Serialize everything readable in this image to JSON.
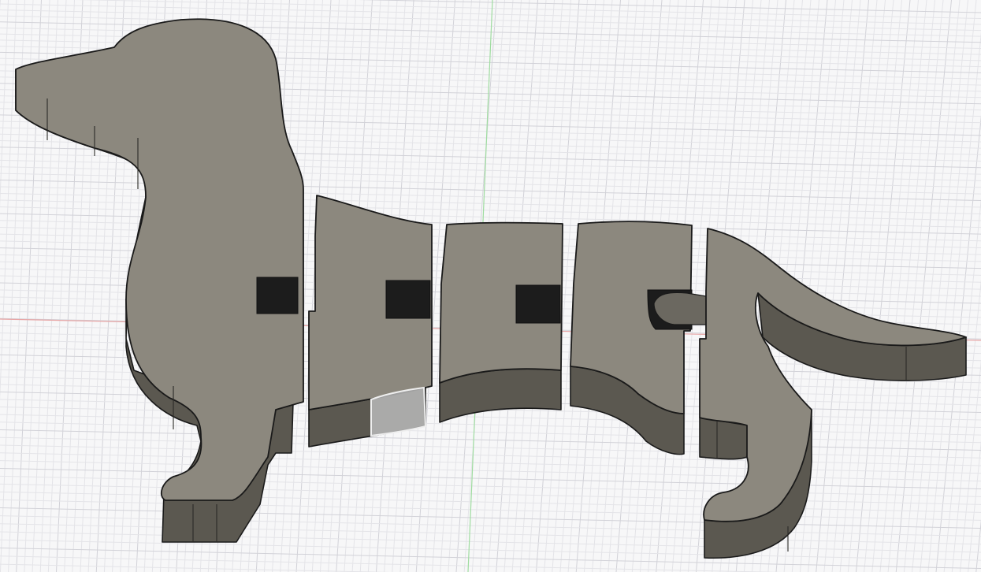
{
  "viewport": {
    "kind": "3d-design-canvas",
    "model": "segmented-dog-body",
    "colors": {
      "background": "#f7f7f8",
      "grid_minor": "#e4e4e8",
      "grid_major": "#d2d2d8",
      "x_axis": "#e8a6a6",
      "y_axis": "#9fdca0",
      "body_top": "#8c887e",
      "body_side": "#5b5850",
      "slot": "#1c1c1c",
      "selection_highlight": "#b9b9b9"
    },
    "icons": {
      "selected_face": "selected-face-highlight"
    }
  }
}
